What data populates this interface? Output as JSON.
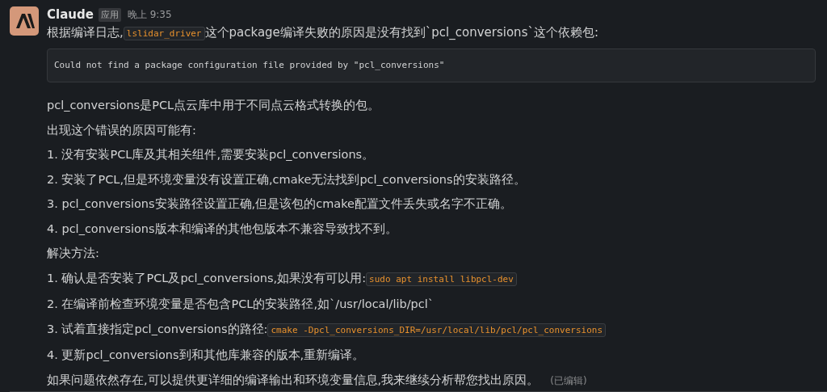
{
  "message": {
    "author": "Claude",
    "badge": "应用",
    "time": "晚上 9:35",
    "intro": [
      {
        "kind": "text",
        "text": "根据编译日志,"
      },
      {
        "kind": "code",
        "text": "lslidar_driver"
      },
      {
        "kind": "text",
        "text": "这个package编译失败的原因是没有找到`pcl_conversions`这个依赖包:"
      }
    ],
    "code_block": "Could not find a package configuration file provided by \"pcl_conversions\"",
    "paragraphs": [
      [
        {
          "kind": "text",
          "text": "pcl_conversions是PCL点云库中用于不同点云格式转换的包。"
        }
      ],
      [
        {
          "kind": "text",
          "text": "出现这个错误的原因可能有:"
        }
      ],
      [
        {
          "kind": "text",
          "text": "1. 没有安装PCL库及其相关组件,需要安装pcl_conversions。"
        }
      ],
      [
        {
          "kind": "text",
          "text": "2. 安装了PCL,但是环境变量没有设置正确,cmake无法找到pcl_conversions的安装路径。"
        }
      ],
      [
        {
          "kind": "text",
          "text": "3. pcl_conversions安装路径设置正确,但是该包的cmake配置文件丢失或名字不正确。"
        }
      ],
      [
        {
          "kind": "text",
          "text": "4. pcl_conversions版本和编译的其他包版本不兼容导致找不到。"
        }
      ],
      [
        {
          "kind": "text",
          "text": "解决方法:"
        }
      ],
      [
        {
          "kind": "text",
          "text": "1. 确认是否安装了PCL及pcl_conversions,如果没有可以用:"
        },
        {
          "kind": "code",
          "text": "sudo apt install libpcl-dev"
        }
      ],
      [
        {
          "kind": "text",
          "text": "2. 在编译前检查环境变量是否包含PCL的安装路径,如`/usr/local/lib/pcl`"
        }
      ],
      [
        {
          "kind": "text",
          "text": "3. 试着直接指定pcl_conversions的路径:"
        },
        {
          "kind": "code",
          "text": "cmake -Dpcl_conversions_DIR=/usr/local/lib/pcl/pcl_conversions"
        }
      ],
      [
        {
          "kind": "text",
          "text": "4. 更新pcl_conversions到和其他库兼容的版本,重新编译。"
        }
      ],
      [
        {
          "kind": "text",
          "text": "如果问题依然存在,可以提供更详细的编译输出和环境变量信息,我来继续分析帮您找出原因。"
        }
      ]
    ],
    "edited": "(已编辑)"
  }
}
